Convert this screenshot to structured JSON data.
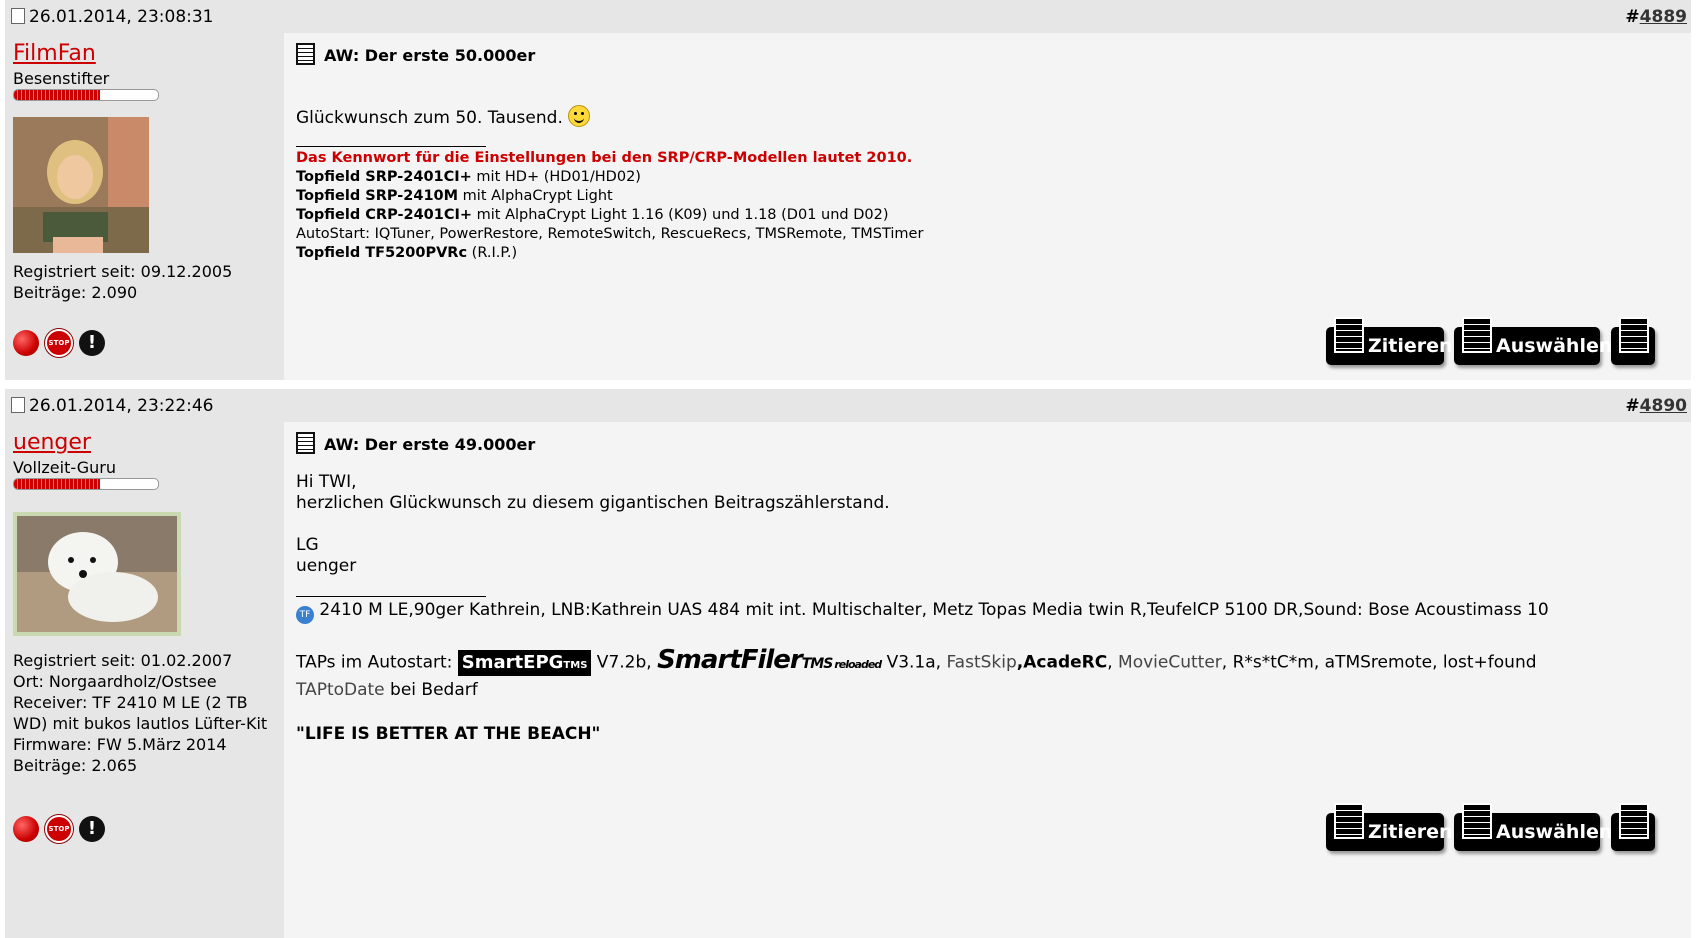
{
  "posts": [
    {
      "date": "26.01.2014, 23:08:31",
      "post_number_prefix": "#",
      "post_number": "4889",
      "user": {
        "name": "FilmFan",
        "rank": "Besenstifter",
        "registered": "Registriert seit: 09.12.2005",
        "posts": "Beiträge: 2.090"
      },
      "title": "AW: Der erste 50.000er",
      "body": "Glückwunsch zum 50. Tausend.",
      "signature": {
        "red_line": "Das Kennwort für die Einstellungen bei den SRP/CRP-Modellen lautet 2010.",
        "lines": [
          {
            "bold": "Topfield SRP-2401CI+",
            "rest": " mit HD+ (HD01/HD02)"
          },
          {
            "bold": "Topfield SRP-2410M",
            "rest": " mit AlphaCrypt Light"
          },
          {
            "bold": "Topfield CRP-2401CI+",
            "rest": " mit AlphaCrypt Light 1.16 (K09) und 1.18 (D01 und D02)"
          },
          {
            "bold": "",
            "rest": "AutoStart: IQTuner, PowerRestore, RemoteSwitch, RescueRecs, TMSRemote, TMSTimer"
          },
          {
            "bold": "Topfield TF5200PVRc",
            "rest": " (R.I.P.)"
          }
        ]
      },
      "buttons": {
        "quote": "Zitieren",
        "select": "Auswählen"
      }
    },
    {
      "date": "26.01.2014, 23:22:46",
      "post_number_prefix": "#",
      "post_number": "4890",
      "user": {
        "name": "uenger",
        "rank": "Vollzeit-Guru",
        "registered": "Registriert seit: 01.02.2007",
        "location": "Ort: Norgaardholz/Ostsee",
        "receiver": "Receiver: TF 2410 M LE (2 TB WD) mit bukos lautlos Lüfter-Kit",
        "firmware": "Firmware: FW 5.März 2014",
        "posts": "Beiträge: 2.065"
      },
      "title": "AW: Der erste 49.000er",
      "body_lines": [
        "Hi TWI,",
        "herzlichen Glückwunsch zu diesem gigantischen Beitragszählerstand.",
        "",
        "LG",
        "uenger"
      ],
      "signature": {
        "tf_badge": "TF",
        "equipment": "2410 M LE,90ger Kathrein, LNB:Kathrein UAS 484 mit int. Multischalter, Metz Topas Media twin R,TeufelCP 5100 DR,Sound: Bose Acoustimass 10",
        "taps_label": "TAPs im Autostart: ",
        "smartepg_logo": "SmartEPG",
        "smartepg_suffix": "TMS",
        "smartepg_version": " V7.2b, ",
        "smartfiler_logo": "SmartFiler",
        "smartfiler_suffix": "TMS",
        "smartfiler_tag": "reloaded",
        "smartfiler_version": " V3.1a, ",
        "fastskip": "FastSkip",
        "acaderc": ",AcadeRC",
        "sep1": ", ",
        "moviecutter": "MovieCutter",
        "rest": ", R*s*tC*m, aTMSremote, lost+found",
        "taptodate": "TAPtoDate",
        "bedarf": " bei Bedarf",
        "motto": "\"LIFE IS BETTER AT THE BEACH\""
      },
      "buttons": {
        "quote": "Zitieren",
        "select": "Auswählen"
      }
    }
  ]
}
